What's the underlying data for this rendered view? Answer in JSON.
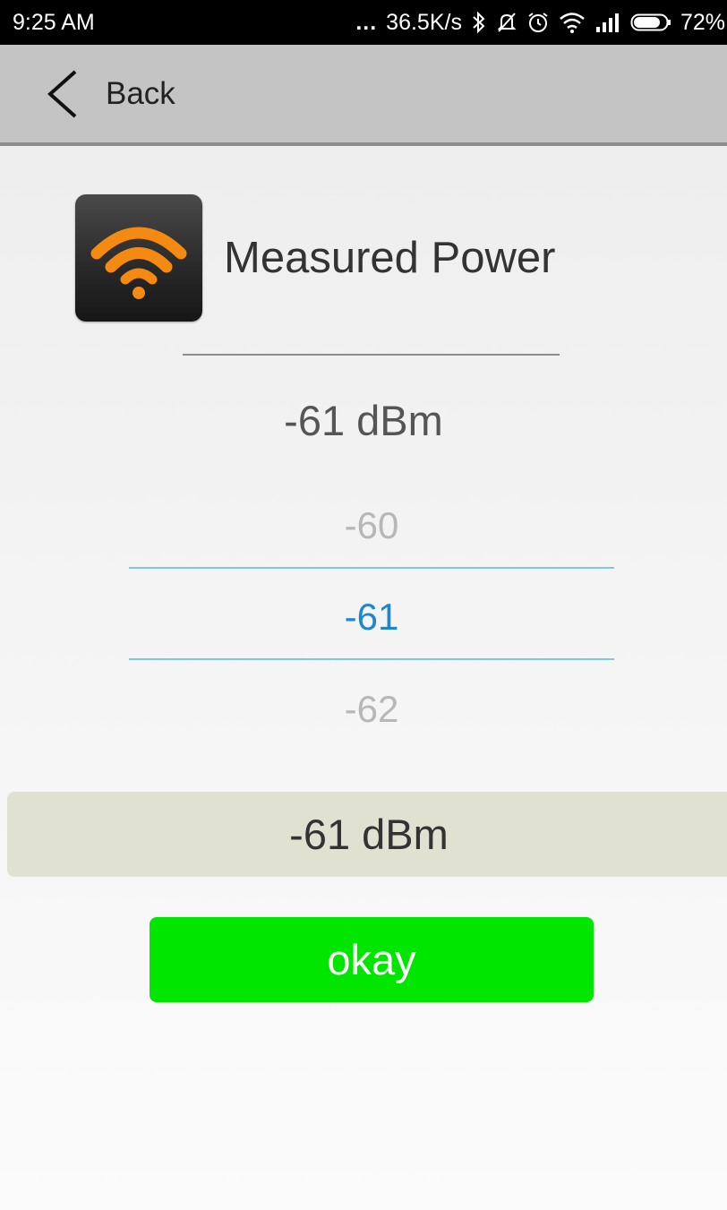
{
  "status_bar": {
    "time": "9:25 AM",
    "dots": "...",
    "net_speed": "36.5K/s",
    "battery": "72%",
    "icons": [
      "bluetooth-icon",
      "mute-icon",
      "alarm-icon",
      "wifi-icon",
      "signal-icon",
      "battery-icon"
    ]
  },
  "header": {
    "back_label": "Back"
  },
  "dialog": {
    "title": "Measured Power",
    "current_value": "-61 dBm",
    "picker": {
      "above": "-60",
      "selected": "-61",
      "below": "-62"
    },
    "result": "-61 dBm",
    "okay_label": "okay"
  },
  "colors": {
    "accent_blue": "#1e86cc",
    "okay_green": "#00e600",
    "icon_orange": "#f58a12"
  }
}
